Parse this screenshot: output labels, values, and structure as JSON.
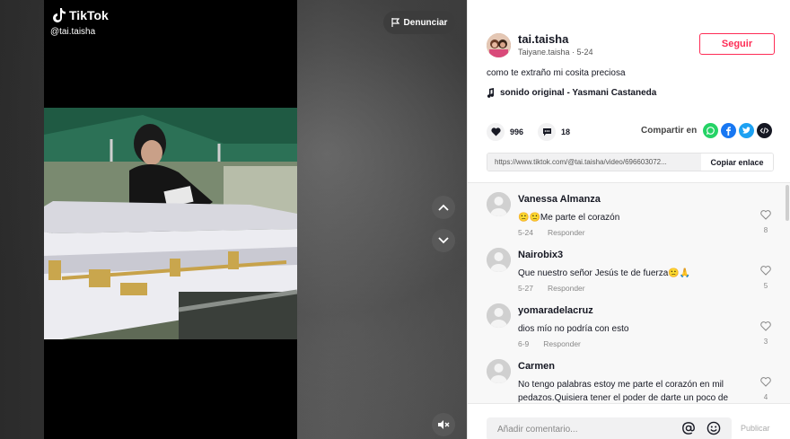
{
  "video": {
    "logo_text": "TikTok",
    "handle": "@tai.taisha",
    "report_label": "Denunciar"
  },
  "author": {
    "name": "tai.taisha",
    "sub": "Taiyane.taisha · 5-24",
    "follow_label": "Seguir"
  },
  "post": {
    "caption": "como te extraño mi cosita preciosa",
    "music": "sonido original - Yasmani Castaneda",
    "likes": "996",
    "comments": "18",
    "share_label": "Compartir en",
    "link": "https://www.tiktok.com/@tai.taisha/video/696603072...",
    "copy_label": "Copiar enlace"
  },
  "share_icons": [
    {
      "name": "whatsapp-icon",
      "color": "#25d366"
    },
    {
      "name": "facebook-icon",
      "color": "#1877f2"
    },
    {
      "name": "twitter-icon",
      "color": "#1da1f2"
    },
    {
      "name": "embed-icon",
      "color": "#161823"
    }
  ],
  "comments": [
    {
      "name": "Vanessa Almanza",
      "text": "🙁🙁Me parte el corazón",
      "date": "5-24",
      "reply": "Responder",
      "likes": "8"
    },
    {
      "name": "Nairobix3",
      "text": "Que nuestro señor Jesús te de fuerza🙁🙏",
      "date": "5-27",
      "reply": "Responder",
      "likes": "5"
    },
    {
      "name": "yomaradelacruz",
      "text": "dios mío no podría con esto",
      "date": "6-9",
      "reply": "Responder",
      "likes": "3"
    },
    {
      "name": "Carmen",
      "text": "No tengo palabras estoy me parte el corazón en mil pedazos.Quisiera tener el poder de darte un poco de",
      "date": "",
      "reply": "",
      "likes": "4"
    }
  ],
  "comment_bar": {
    "placeholder": "Añadir comentario...",
    "post_label": "Publicar"
  }
}
